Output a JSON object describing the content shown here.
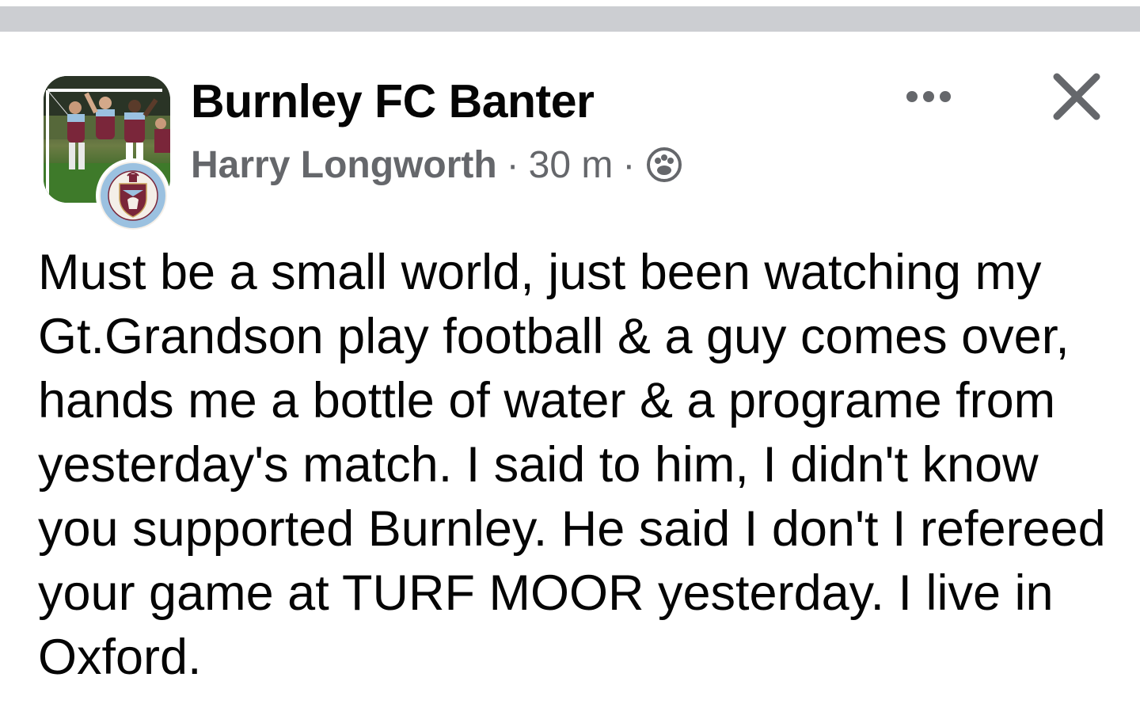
{
  "post": {
    "group_name": "Burnley FC Banter",
    "author": "Harry Longworth",
    "separator": "·",
    "time": "30 m",
    "privacy_icon": "group-privacy-icon",
    "more_icon": "more-options-icon",
    "close_icon": "close-icon",
    "body_text": "Must be a small world, just been watching my Gt.Grandson play football & a guy comes over, hands me a bottle of water & a programe from yesterday's match. I said to him, I didn't know you supported Burnley. He said I don't I refereed your game at TURF MOOR yesterday. I live in Oxford."
  },
  "colors": {
    "text_primary": "#050505",
    "text_secondary": "#65676b",
    "top_bar": "#ccced2",
    "crest_claret": "#7a263a",
    "crest_blue": "#9bc1e0"
  }
}
